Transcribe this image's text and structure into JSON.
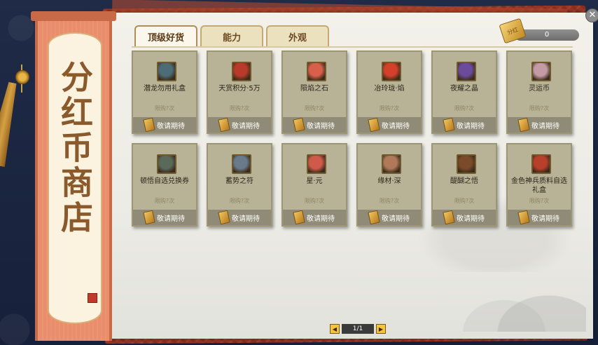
{
  "banner": {
    "title": "分红币商店"
  },
  "tabs": [
    {
      "label": "顶级好货",
      "active": true
    },
    {
      "label": "能力",
      "active": false
    },
    {
      "label": "外观",
      "active": false
    }
  ],
  "currency": {
    "value": "0",
    "icon_text": "分红"
  },
  "items": [
    {
      "name": "潜龙勿用礼盒",
      "limit": "限购?次",
      "action": "敬请期待",
      "icon": "gift-box-icon",
      "color": "#4c6c78"
    },
    {
      "name": "天赏积分·5万",
      "limit": "限购?次",
      "action": "敬请期待",
      "icon": "treasure-chest-icon",
      "color": "#b83a2a"
    },
    {
      "name": "陨焰之石",
      "limit": "限购?次",
      "action": "敬请期待",
      "icon": "fire-stone-icon",
      "color": "#d8604a"
    },
    {
      "name": "冶玲珑·焰",
      "limit": "限购?次",
      "action": "敬请期待",
      "icon": "flame-gem-icon",
      "color": "#d4402a"
    },
    {
      "name": "夜耀之晶",
      "limit": "限购?次",
      "action": "敬请期待",
      "icon": "purple-crystal-icon",
      "color": "#6b4b9a"
    },
    {
      "name": "灵运币",
      "limit": "限购?次",
      "action": "敬请期待",
      "icon": "spirit-coin-icon",
      "color": "#c49aa6"
    },
    {
      "name": "顿悟自选兑换券",
      "limit": "限购?次",
      "action": "敬请期待",
      "icon": "voucher-icon",
      "color": "#5a6a5a"
    },
    {
      "name": "蓄势之符",
      "limit": "限购?次",
      "action": "敬请期待",
      "icon": "talisman-icon",
      "color": "#6a7a8a"
    },
    {
      "name": "星·元",
      "limit": "限购?次",
      "action": "敬请期待",
      "icon": "star-essence-icon",
      "color": "#d05a4a"
    },
    {
      "name": "缘材·深",
      "limit": "限购?次",
      "action": "敬请期待",
      "icon": "fate-material-icon",
      "color": "#b07a5a"
    },
    {
      "name": "醍醐之悟",
      "limit": "限购?次",
      "action": "敬请期待",
      "icon": "gourd-icon",
      "color": "#7a4a2a"
    },
    {
      "name": "金色神兵质料自选礼盒",
      "limit": "限购?次",
      "action": "敬请期待",
      "icon": "red-gift-box-icon",
      "color": "#b8402a"
    }
  ],
  "pager": {
    "text": "1/1",
    "prev": "◀",
    "next": "▶"
  },
  "close": "✕"
}
